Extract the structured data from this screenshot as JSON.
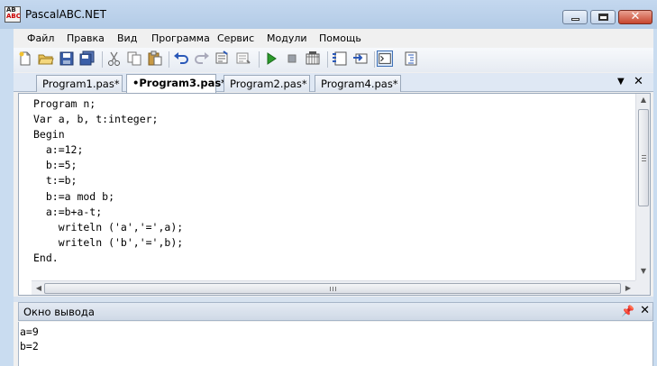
{
  "window": {
    "title": "PascalABC.NET"
  },
  "menu": [
    "Файл",
    "Правка",
    "Вид",
    "Программа",
    "Сервис",
    "Модули",
    "Помощь"
  ],
  "toolbar_icons": [
    "new-file-icon",
    "open-folder-icon",
    "save-icon",
    "save-all-icon",
    "cut-icon",
    "copy-icon",
    "paste-icon",
    "undo-icon",
    "redo-icon",
    "find-icon",
    "replace-icon",
    "run-icon",
    "stop-icon",
    "compile-icon",
    "output-window-icon",
    "debug-icon",
    "console-icon",
    "format-icon"
  ],
  "tabs": [
    {
      "label": "Program1.pas*",
      "active": false
    },
    {
      "label": "•Program3.pas*",
      "active": true
    },
    {
      "label": "Program2.pas*",
      "active": false
    },
    {
      "label": "Program4.pas*",
      "active": false
    }
  ],
  "editor": {
    "lines": [
      "Program n;",
      "Var a, b, t:integer;",
      "Begin",
      "  a:=12;",
      "  b:=5;",
      "  t:=b;",
      "  b:=a mod b;",
      "  a:=b+a-t;",
      "    writeln ('a','=',a);",
      "    writeln ('b','=',b);",
      "End."
    ]
  },
  "output": {
    "title": "Окно вывода",
    "lines": [
      "a=9",
      "b=2"
    ]
  },
  "colors": {
    "titlebar": "#c4d8ef",
    "number_literal": "#2b2bd9",
    "close_button": "#c7452d"
  }
}
